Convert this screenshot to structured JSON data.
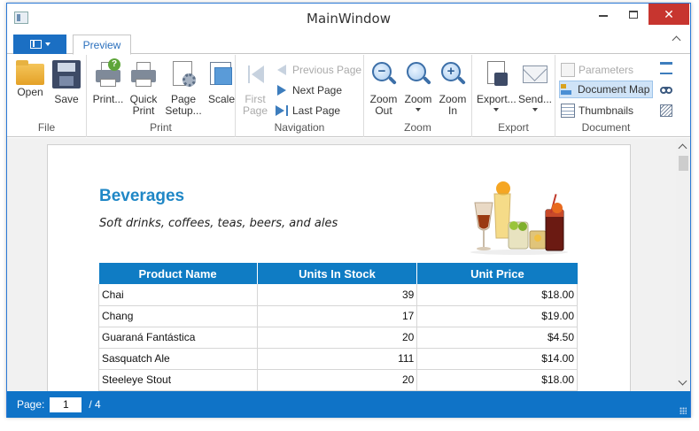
{
  "window": {
    "title": "MainWindow"
  },
  "tabs": [
    {
      "label": "Preview"
    }
  ],
  "ribbon": {
    "file": {
      "label": "File",
      "open": "Open",
      "save": "Save"
    },
    "print": {
      "label": "Print",
      "print": "Print...",
      "quick_print_1": "Quick",
      "quick_print_2": "Print",
      "page_setup_1": "Page",
      "page_setup_2": "Setup...",
      "scale": "Scale"
    },
    "navigation": {
      "label": "Navigation",
      "first_page_1": "First",
      "first_page_2": "Page",
      "previous_page": "Previous Page",
      "next_page": "Next Page",
      "last_page": "Last Page"
    },
    "zoom": {
      "label": "Zoom",
      "zoom_out_1": "Zoom",
      "zoom_out_2": "Out",
      "zoom": "Zoom",
      "zoom_in_1": "Zoom",
      "zoom_in_2": "In"
    },
    "export": {
      "label": "Export",
      "export": "Export...",
      "send": "Send..."
    },
    "document": {
      "label": "Document",
      "parameters": "Parameters",
      "document_map": "Document Map",
      "thumbnails": "Thumbnails"
    }
  },
  "report": {
    "title": "Beverages",
    "subtitle": "Soft drinks, coffees, teas, beers, and ales",
    "columns": [
      "Product Name",
      "Units In Stock",
      "Unit Price"
    ],
    "rows": [
      {
        "name": "Chai",
        "stock": "39",
        "price": "$18.00"
      },
      {
        "name": "Chang",
        "stock": "17",
        "price": "$19.00"
      },
      {
        "name": "Guaraná Fantástica",
        "stock": "20",
        "price": "$4.50"
      },
      {
        "name": "Sasquatch Ale",
        "stock": "111",
        "price": "$14.00"
      },
      {
        "name": "Steeleye Stout",
        "stock": "20",
        "price": "$18.00"
      }
    ]
  },
  "status": {
    "page_label": "Page:",
    "current_page": "1",
    "total_pages": "/ 4"
  },
  "colors": {
    "accent": "#0f73c7",
    "title_blue": "#1f87c6",
    "close_red": "#c7352f"
  }
}
